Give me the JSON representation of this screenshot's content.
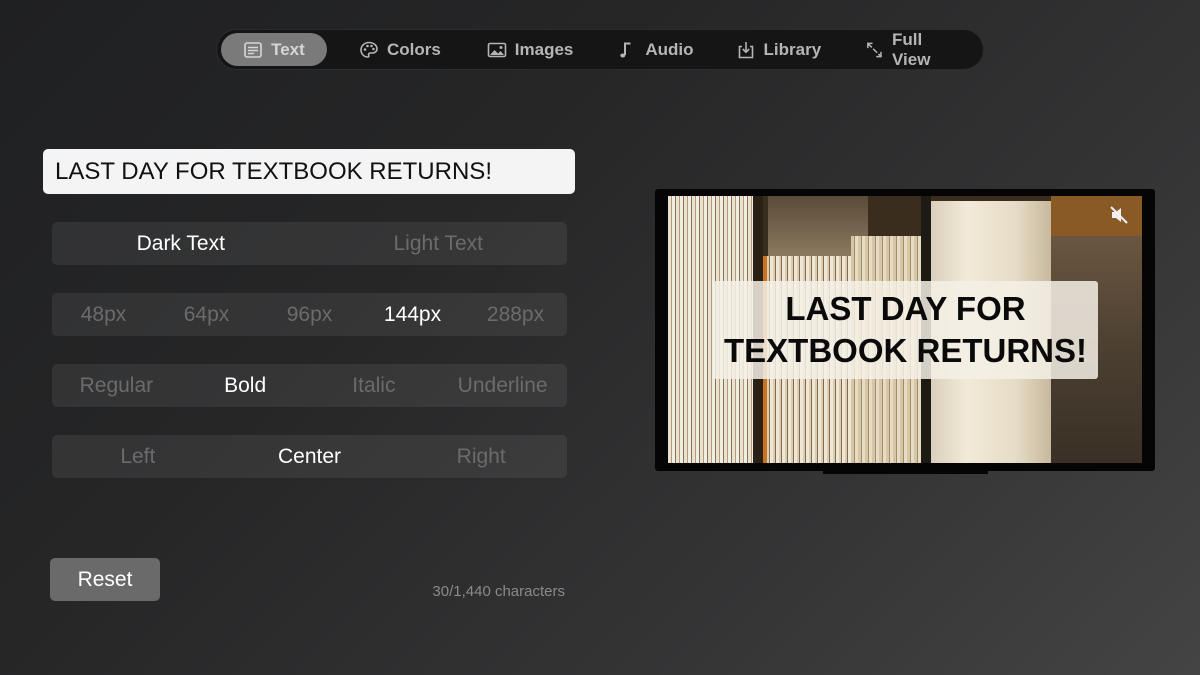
{
  "nav": {
    "items": [
      {
        "label": "Text",
        "icon": "text-icon",
        "active": true
      },
      {
        "label": "Colors",
        "icon": "palette-icon",
        "active": false
      },
      {
        "label": "Images",
        "icon": "image-icon",
        "active": false
      },
      {
        "label": "Audio",
        "icon": "music-note-icon",
        "active": false
      },
      {
        "label": "Library",
        "icon": "download-tray-icon",
        "active": false
      },
      {
        "label": "Full View",
        "icon": "expand-arrows-icon",
        "active": false
      }
    ]
  },
  "editor": {
    "text_value": "LAST DAY FOR TEXTBOOK RETURNS!",
    "text_color": {
      "options": [
        "Dark Text",
        "Light Text"
      ],
      "selected": "Dark Text"
    },
    "size": {
      "options": [
        "48px",
        "64px",
        "96px",
        "144px",
        "288px"
      ],
      "selected": "144px"
    },
    "style": {
      "options": [
        "Regular",
        "Bold",
        "Italic",
        "Underline"
      ],
      "selected": "Bold"
    },
    "alignment": {
      "options": [
        "Left",
        "Center",
        "Right"
      ],
      "selected": "Center"
    },
    "reset_label": "Reset",
    "char_count": "30/1,440 characters"
  },
  "preview": {
    "overlay_text": "LAST DAY FOR\nTEXTBOOK RETURNS!",
    "muted": true,
    "mute_icon": "speaker-muted-icon"
  },
  "colors": {
    "active_tab_bg": "#7a7a7a",
    "input_bg": "#f4f4f4",
    "selected_option": "#ffffff",
    "unselected_option": "#6b6b6b"
  }
}
